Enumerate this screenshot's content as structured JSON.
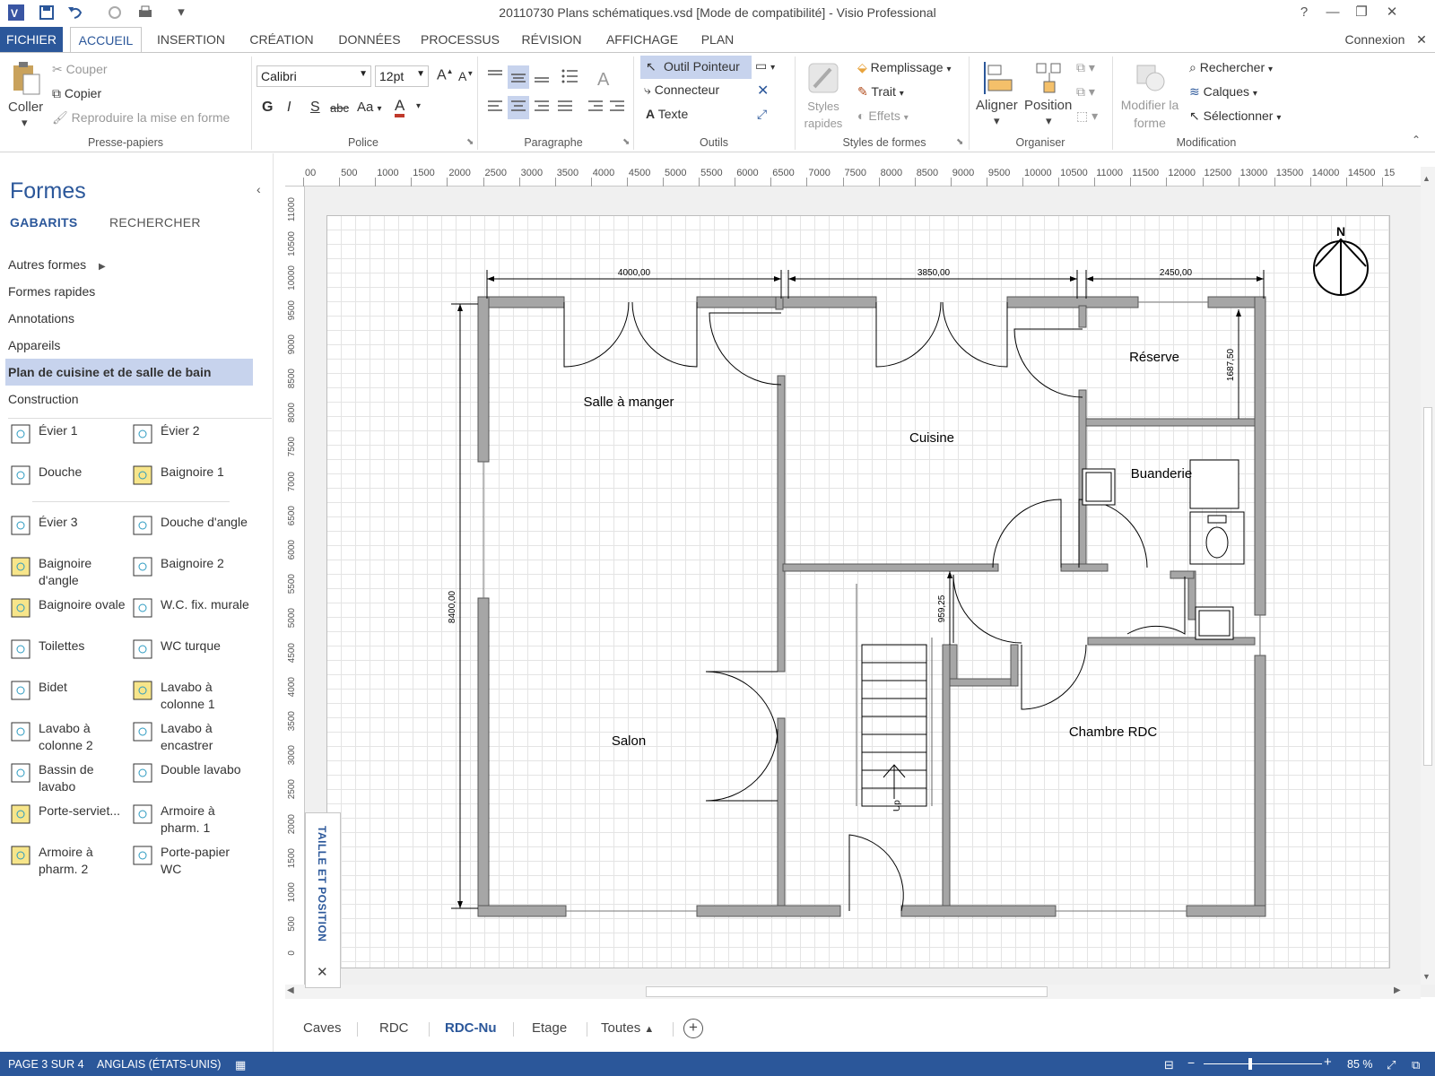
{
  "window": {
    "title": "20110730 Plans schématiques.vsd  [Mode de compatibilité] - Visio Professional",
    "help": "?",
    "signin": "Connexion"
  },
  "ribbon_tabs": [
    "FICHIER",
    "ACCUEIL",
    "INSERTION",
    "CRÉATION",
    "DONNÉES",
    "PROCESSUS",
    "RÉVISION",
    "AFFICHAGE",
    "PLAN"
  ],
  "ribbon": {
    "clipboard": {
      "paste": "Coller",
      "cut": "Couper",
      "copy": "Copier",
      "format_painter": "Reproduire la mise en forme",
      "group": "Presse-papiers"
    },
    "font": {
      "name": "Calibri",
      "size": "12pt",
      "bold": "G",
      "italic": "I",
      "underline": "S",
      "strike": "abc",
      "case": "Aa",
      "color_letter": "A",
      "group": "Police"
    },
    "paragraph": {
      "group": "Paragraphe"
    },
    "tools": {
      "pointer": "Outil Pointeur",
      "connector": "Connecteur",
      "text": "Texte",
      "group": "Outils"
    },
    "shape_styles": {
      "quick_styles": "Styles rapides",
      "fill": "Remplissage",
      "line": "Trait",
      "effects": "Effets",
      "group": "Styles de formes"
    },
    "arrange": {
      "align": "Aligner",
      "position": "Position",
      "group": "Organiser"
    },
    "editing": {
      "modify_shape": "Modifier la forme",
      "find": "Rechercher",
      "layers": "Calques",
      "select": "Sélectionner",
      "group": "Modification"
    }
  },
  "shapes_pane": {
    "title": "Formes",
    "tabs": [
      "GABARITS",
      "RECHERCHER"
    ],
    "stencils": [
      "Autres formes",
      "Formes rapides",
      "Annotations",
      "Appareils",
      "Plan de cuisine et de salle de bain",
      "Construction"
    ],
    "selected_stencil": "Plan de cuisine et de salle de bain",
    "masters": [
      "Évier 1",
      "Évier 2",
      "Douche",
      "Baignoire 1",
      "Évier 3",
      "Douche d'angle",
      "Baignoire d'angle",
      "Baignoire 2",
      "Baignoire ovale",
      "W.C. fix. murale",
      "Toilettes",
      "WC turque",
      "Bidet",
      "Lavabo à colonne 1",
      "Lavabo à colonne 2",
      "Lavabo à encastrer",
      "Bassin de lavabo",
      "Double lavabo",
      "Porte-serviet...",
      "Armoire à pharm. 1",
      "Armoire à pharm. 2",
      "Porte-papier WC"
    ]
  },
  "ruler": {
    "h_ticks": [
      "00",
      "500",
      "1000",
      "1500",
      "2000",
      "2500",
      "3000",
      "3500",
      "4000",
      "4500",
      "5000",
      "5500",
      "6000",
      "6500",
      "7000",
      "7500",
      "8000",
      "8500",
      "9000",
      "9500",
      "10000",
      "10500",
      "11000",
      "11500",
      "12000",
      "12500",
      "13000",
      "13500",
      "14000",
      "14500",
      "15"
    ],
    "v_ticks": [
      "11000",
      "10500",
      "10000",
      "9500",
      "9000",
      "8500",
      "8000",
      "7500",
      "7000",
      "6500",
      "6000",
      "5500",
      "5000",
      "4500",
      "4000",
      "3500",
      "3000",
      "2500",
      "2000",
      "1500",
      "1000",
      "500",
      "0"
    ]
  },
  "floorplan": {
    "rooms": [
      "Salle à manger",
      "Cuisine",
      "Réserve",
      "Buanderie",
      "Salon",
      "Chambre RDC"
    ],
    "dimensions": [
      "4000,00",
      "3850,00",
      "2450,00",
      "8400,00",
      "1687,50",
      "959,25"
    ],
    "compass": "N",
    "stairs": "Up"
  },
  "size_position": {
    "label": "TAILLE ET POSITION",
    "close": "✕"
  },
  "page_tabs": [
    "Caves",
    "RDC",
    "RDC-Nu",
    "Etage",
    "Toutes"
  ],
  "active_page": "RDC-Nu",
  "status": {
    "page": "PAGE 3 SUR 4",
    "language": "ANGLAIS (ÉTATS-UNIS)",
    "zoom": "85 %"
  },
  "colors": {
    "accent": "#2b579a",
    "selection": "#c7d3ed",
    "wall": "#a6a6a6"
  }
}
